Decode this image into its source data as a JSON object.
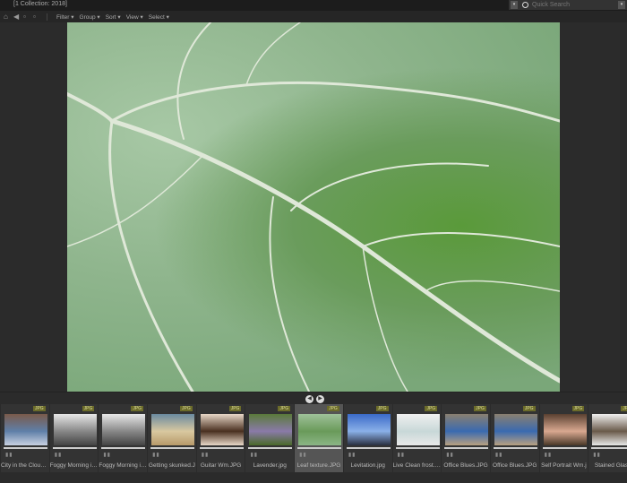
{
  "window": {
    "title": "[1 Collection: 2018]"
  },
  "search": {
    "placeholder": "Quick Search"
  },
  "toolbar": {
    "menus": [
      "Filter",
      "Group",
      "Sort",
      "View",
      "Select"
    ]
  },
  "viewer": {
    "image": "Leaf texture.JPG"
  },
  "filmstrip": {
    "items": [
      {
        "name": "City in the Clouds ...",
        "type": "JPG",
        "colors": [
          "#7a5a4a",
          "#5f7fa8",
          "#c8d0e0"
        ]
      },
      {
        "name": "Foggy Morning in...",
        "type": "JPG",
        "colors": [
          "#e8e8e8",
          "#888",
          "#444"
        ]
      },
      {
        "name": "Foggy Morning in...",
        "type": "JPG",
        "colors": [
          "#e8e8e8",
          "#888",
          "#444"
        ]
      },
      {
        "name": "Getting skunked.J",
        "type": "JPG",
        "colors": [
          "#6a8aa0",
          "#d8c8a0",
          "#b89a6a"
        ]
      },
      {
        "name": "Guitar Wm.JPG",
        "type": "JPG",
        "colors": [
          "#e8d8c8",
          "#4a3020",
          "#e8d8c8"
        ]
      },
      {
        "name": "Lavender.jpg",
        "type": "JPG",
        "colors": [
          "#5a7a3a",
          "#8a7aa8",
          "#4a6a2a"
        ]
      },
      {
        "name": "Leaf texture.JPG",
        "type": "JPG",
        "colors": [
          "#9fc29a",
          "#6a9a5a",
          "#8ab585"
        ],
        "selected": true
      },
      {
        "name": "Levitation.jpg",
        "type": "JPG",
        "colors": [
          "#3a6ac8",
          "#8ab0e8",
          "#2a3040"
        ]
      },
      {
        "name": "Live Clean frost.jpg",
        "type": "JPG",
        "colors": [
          "#f0f0f0",
          "#c8d8d8",
          "#e8e8e8"
        ]
      },
      {
        "name": "Office Blues.JPG",
        "type": "JPG",
        "colors": [
          "#8a8070",
          "#3a6ab0",
          "#b8a080"
        ]
      },
      {
        "name": "Office Blues.JPG",
        "type": "JPG",
        "colors": [
          "#8a8070",
          "#3a6ab0",
          "#b8a080"
        ]
      },
      {
        "name": "Self Portrait Wm.j",
        "type": "JPG",
        "colors": [
          "#5a4030",
          "#d8a890",
          "#4a3828"
        ]
      },
      {
        "name": "Stained Glass",
        "type": "JPG",
        "colors": [
          "#f0f0f0",
          "#6a5a4a",
          "#e8e8e8"
        ]
      }
    ]
  }
}
